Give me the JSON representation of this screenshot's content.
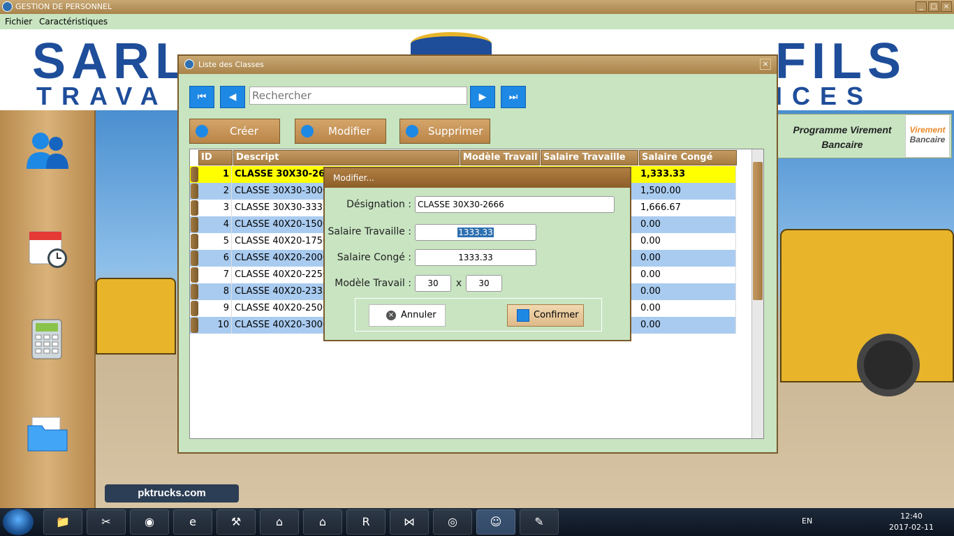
{
  "window": {
    "title": "GESTION DE PERSONNEL"
  },
  "menu": [
    "Fichier",
    "Caractéristiques"
  ],
  "banner": {
    "line1": "SARL",
    "line1b": "FILS",
    "line2": "TRAVA",
    "line2b": "ICES"
  },
  "watermark": "pktrucks.com",
  "program_box": {
    "title": "Programme Virement Bancaire",
    "logo_top": "Virement",
    "logo_bottom": "Bancaire"
  },
  "list_window": {
    "title": "Liste des Classes",
    "search_placeholder": "Rechercher",
    "buttons": {
      "create": "Créer",
      "modify": "Modifier",
      "delete": "Supprimer"
    },
    "columns": [
      "ID",
      "Descript",
      "Modèle Travail",
      "Salaire Travaille",
      "Salaire Congé"
    ],
    "rows": [
      {
        "id": "1",
        "desc": "CLASSE 30X30-26",
        "conge": "1,333.33"
      },
      {
        "id": "2",
        "desc": "CLASSE 30X30-3000",
        "conge": "1,500.00"
      },
      {
        "id": "3",
        "desc": "CLASSE 30X30-3333",
        "conge": "1,666.67"
      },
      {
        "id": "4",
        "desc": "CLASSE 40X20-1500",
        "conge": "0.00"
      },
      {
        "id": "5",
        "desc": "CLASSE 40X20-1750",
        "conge": "0.00"
      },
      {
        "id": "6",
        "desc": "CLASSE 40X20-2000",
        "conge": "0.00"
      },
      {
        "id": "7",
        "desc": "CLASSE 40X20-2250",
        "conge": "0.00"
      },
      {
        "id": "8",
        "desc": "CLASSE 40X20-2333",
        "conge": "0.00"
      },
      {
        "id": "9",
        "desc": "CLASSE 40X20-2500",
        "conge": "0.00"
      },
      {
        "id": "10",
        "desc": "CLASSE 40X20-3000",
        "conge": "0.00"
      }
    ]
  },
  "modal": {
    "title": "Modifier...",
    "designation_label": "Désignation :",
    "designation_value": "CLASSE 30X30-2666",
    "salaire_travaille_label": "Salaire Travaille :",
    "salaire_travaille_value": "1333.33",
    "salaire_conge_label": "Salaire Congé :",
    "salaire_conge_value": "1333.33",
    "modele_label": "Modèle Travail :",
    "modele_a": "30",
    "modele_x": "x",
    "modele_b": "30",
    "cancel": "Annuler",
    "confirm": "Confirmer"
  },
  "taskbar": {
    "lang": "EN",
    "time": "12:40",
    "date": "2017-02-11"
  },
  "colors": {
    "selected_row": "#ffff00",
    "alt_row": "#a9cbf0",
    "accent_blue": "#1e88e5",
    "panel_green": "#c8e4c1"
  }
}
